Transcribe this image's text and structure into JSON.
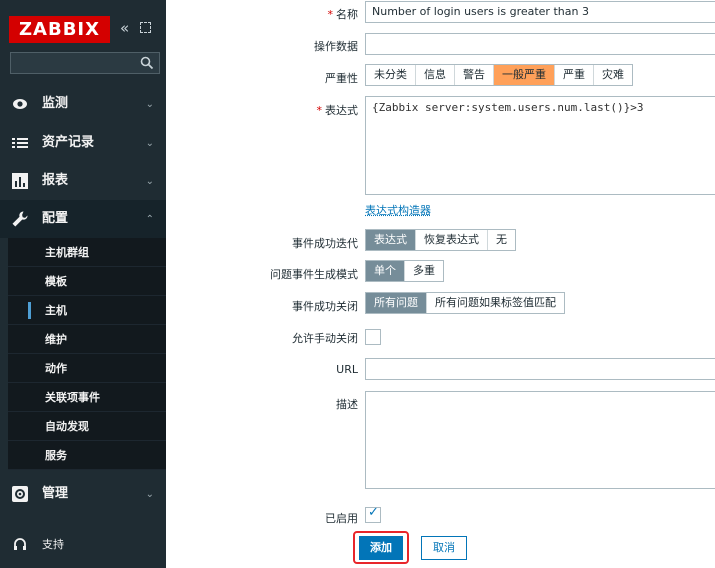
{
  "sidebar": {
    "logo": "ZABBIX",
    "search": {
      "value": "",
      "placeholder": ""
    },
    "menu": [
      {
        "key": "monitoring",
        "label": "监测",
        "icon": "eye-icon"
      },
      {
        "key": "inventory",
        "label": "资产记录",
        "icon": "list-icon"
      },
      {
        "key": "reports",
        "label": "报表",
        "icon": "bar-chart-icon"
      },
      {
        "key": "configuration",
        "label": "配置",
        "icon": "wrench-icon",
        "expanded": true
      },
      {
        "key": "administration",
        "label": "管理",
        "icon": "gear-icon"
      },
      {
        "key": "support",
        "label": "支持",
        "icon": "headset-icon"
      }
    ],
    "submenu": [
      "主机群组",
      "模板",
      "主机",
      "维护",
      "动作",
      "关联项事件",
      "自动发现",
      "服务"
    ],
    "active_submenu": "主机"
  },
  "form": {
    "name": {
      "label": "名称",
      "value": "Number of login users is greater than 3"
    },
    "opdata": {
      "label": "操作数据",
      "value": ""
    },
    "severity": {
      "label": "严重性",
      "options": [
        "未分类",
        "信息",
        "警告",
        "一般严重",
        "严重",
        "灾难"
      ],
      "selected": "一般严重"
    },
    "expression": {
      "label": "表达式",
      "value": "{Zabbix server:system.users.num.last()}>3"
    },
    "expression_constructor": "表达式构造器",
    "ok_event_generation": {
      "label": "事件成功迭代",
      "options": [
        "表达式",
        "恢复表达式",
        "无"
      ],
      "selected": "表达式"
    },
    "problem_event_mode": {
      "label": "问题事件生成模式",
      "options": [
        "单个",
        "多重"
      ],
      "selected": "单个"
    },
    "ok_event_closes": {
      "label": "事件成功关闭",
      "options": [
        "所有问题",
        "所有问题如果标签值匹配"
      ],
      "selected": "所有问题"
    },
    "manual_close": {
      "label": "允许手动关闭",
      "checked": false
    },
    "url": {
      "label": "URL",
      "value": ""
    },
    "description": {
      "label": "描述",
      "value": ""
    },
    "enabled": {
      "label": "已启用",
      "checked": true
    },
    "add_button": "添加",
    "cancel_button": "取消"
  },
  "colors": {
    "sidebar_bg": "#1f2c33",
    "brand_red": "#d40000",
    "accent_blue": "#0275b8",
    "selected_gray": "#768d99",
    "severity_average_orange": "#ffa059",
    "highlight_red": "#e8252a"
  }
}
